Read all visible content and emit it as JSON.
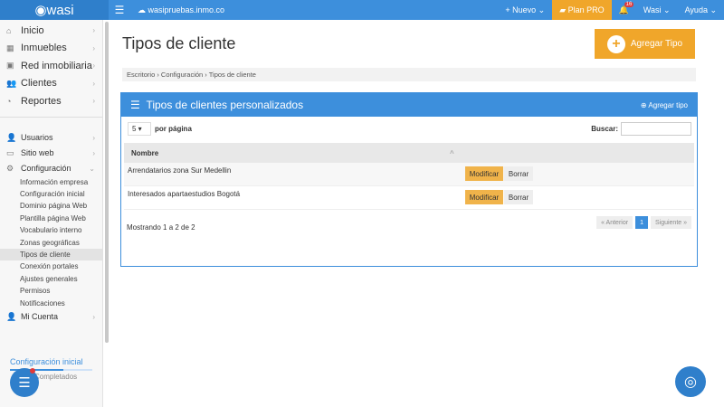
{
  "topbar": {
    "logo": "◉wasi",
    "site": "wasipruebas.inmo.co",
    "nuevo": "+ Nuevo ⌄",
    "plan": "Plan PRO",
    "badge": "16",
    "user": "Wasi ⌄",
    "help": "Ayuda ⌄"
  },
  "sidebar": {
    "main": [
      {
        "icon": "⌂",
        "label": "Inicio"
      },
      {
        "icon": "▦",
        "label": "Inmuebles"
      },
      {
        "icon": "▣",
        "label": "Red inmobiliaria"
      },
      {
        "icon": "👥",
        "label": "Clientes"
      },
      {
        "icon": "◔",
        "label": "Reportes"
      }
    ],
    "second": [
      {
        "icon": "👤",
        "label": "Usuarios"
      },
      {
        "icon": "▭",
        "label": "Sitio web"
      },
      {
        "icon": "⚙",
        "label": "Configuración"
      }
    ],
    "sub": [
      "Información empresa",
      "Configuración inicial",
      "Dominio página Web",
      "Plantilla página Web",
      "Vocabulario interno",
      "Zonas geográficas",
      "Tipos de cliente",
      "Conexión portales",
      "Ajustes generales",
      "Permisos",
      "Notificaciones"
    ],
    "account": "Mi Cuenta",
    "setup_title": "Configuración inicial",
    "setup_progress": 0.65,
    "setup_sub": "Completados"
  },
  "page": {
    "title": "Tipos de cliente",
    "add_button": "Agregar Tipo",
    "breadcrumb": "Escritorio › Configuración › Tipos de cliente"
  },
  "panel": {
    "title": "Tipos de clientes personalizados",
    "add": "Agregar tipo",
    "per_page": "5",
    "per_page_label": "por página",
    "search_label": "Buscar:",
    "col": "Nombre",
    "rows": [
      {
        "name": "Arrendatarios zona Sur Medellin",
        "edit": "Modificar",
        "del": "Borrar"
      },
      {
        "name": "Interesados apartaestudios Bogotá",
        "edit": "Modificar",
        "del": "Borrar"
      }
    ],
    "info": "Mostrando 1 a 2 de 2",
    "prev": "« Anterior",
    "page": "1",
    "next": "Siguiente »"
  }
}
